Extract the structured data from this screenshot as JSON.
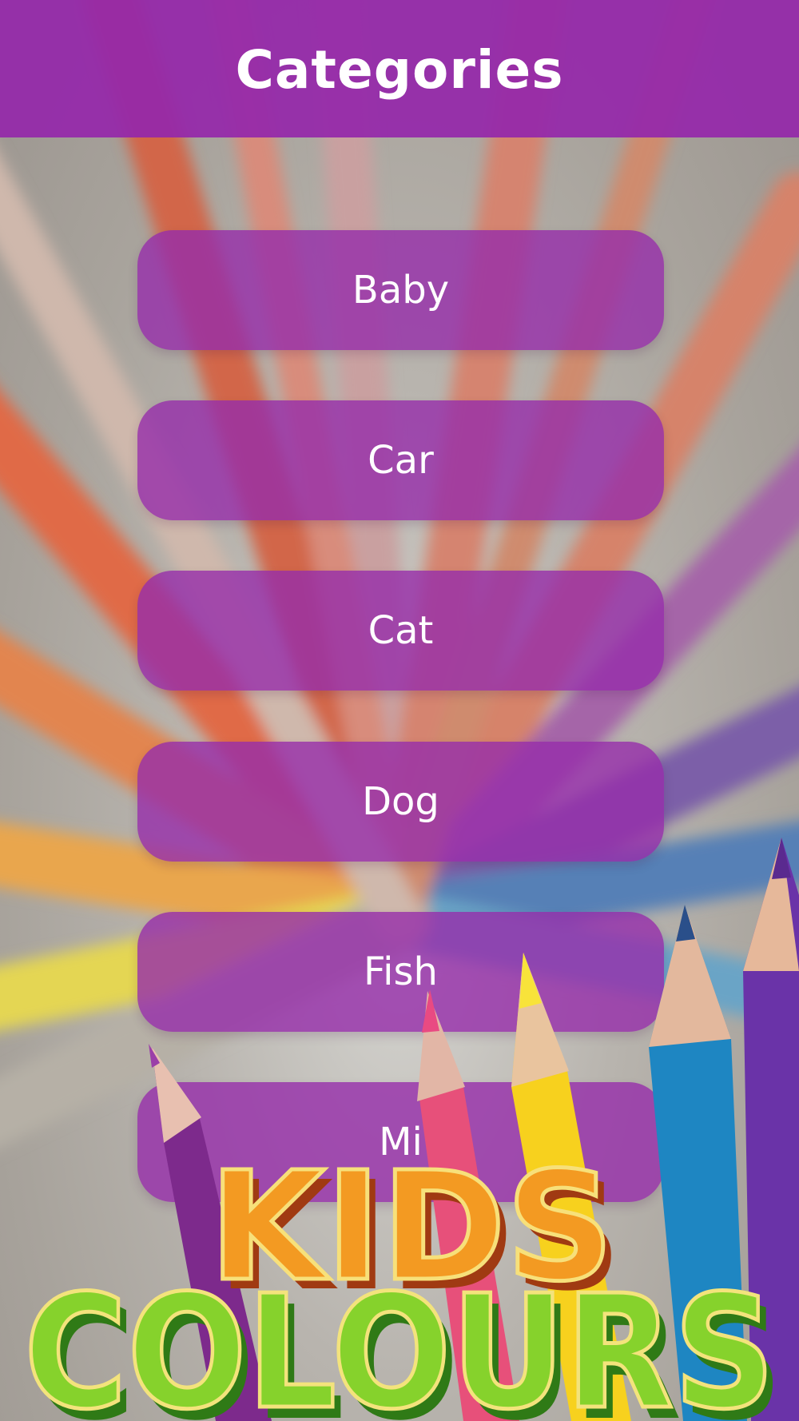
{
  "header": {
    "title": "Categories"
  },
  "categories": [
    {
      "label": "Baby"
    },
    {
      "label": "Car"
    },
    {
      "label": "Cat"
    },
    {
      "label": "Dog"
    },
    {
      "label": "Fish"
    },
    {
      "label": "Mi"
    }
  ],
  "logo": {
    "line1": "KIDS",
    "line2": "COLOURS"
  },
  "colors": {
    "header": "#9428aa",
    "button": "#962daa",
    "logo_orange": "#f08a1c",
    "logo_green": "#7fcf2a",
    "logo_outline": "#f5e27a"
  },
  "icons": [
    "background-pencils-rays",
    "pencil-icon"
  ]
}
